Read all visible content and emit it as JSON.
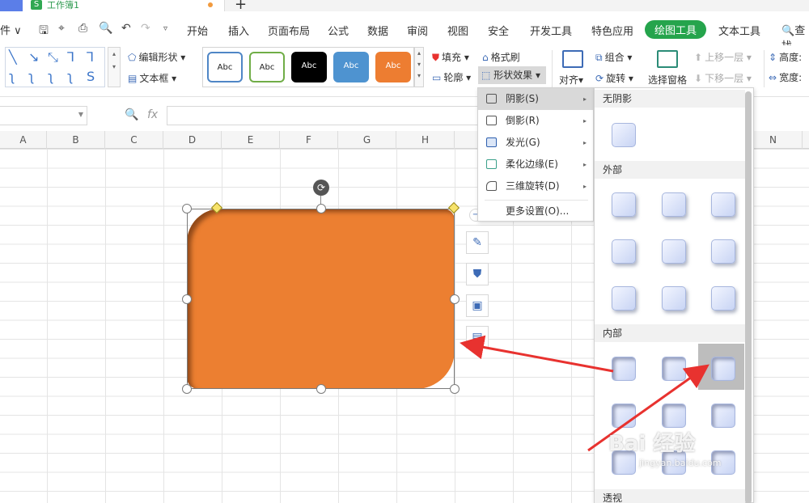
{
  "tabbar": {
    "doc_icon": "S",
    "doc_name": "工作簿1"
  },
  "menubar": {
    "file_label": "件 ∨",
    "items": [
      "开始",
      "插入",
      "页面布局",
      "公式",
      "数据",
      "审阅",
      "视图",
      "安全",
      "开发工具",
      "特色应用",
      "绘图工具",
      "文本工具"
    ],
    "active": "绘图工具",
    "search_label": "查找"
  },
  "ribbon": {
    "edit_shape": "编辑形状",
    "textbox": "文本框",
    "style_labels": [
      "Abc",
      "Abc",
      "Abc",
      "Abc",
      "Abc"
    ],
    "style_colors": [
      "#ffffff",
      "#ffffff",
      "#000000",
      "#4e93d0",
      "#ed7d31"
    ],
    "fill": "填充",
    "format_painter": "格式刷",
    "outline": "轮廓",
    "shape_effects": "形状效果",
    "align": "对齐",
    "group": "组合",
    "rotate": "旋转",
    "selection_pane": "选择窗格",
    "bring_forward": "上移一层",
    "send_backward": "下移一层",
    "height": "高度:",
    "width": "宽度:"
  },
  "formulabar": {
    "fx": "fx",
    "value": ""
  },
  "columns": [
    "A",
    "B",
    "C",
    "D",
    "E",
    "F",
    "G",
    "H",
    "N"
  ],
  "dropdown": {
    "items": [
      {
        "label": "阴影(S)",
        "icon": "shadow-icon",
        "has_sub": true,
        "selected": true
      },
      {
        "label": "倒影(R)",
        "icon": "reflection-icon",
        "has_sub": true
      },
      {
        "label": "发光(G)",
        "icon": "glow-icon",
        "has_sub": true
      },
      {
        "label": "柔化边缘(E)",
        "icon": "soft-edge-icon",
        "has_sub": true
      },
      {
        "label": "三维旋转(D)",
        "icon": "3d-rotate-icon",
        "has_sub": true
      }
    ],
    "more": "更多设置(O)..."
  },
  "submenu": {
    "sections": [
      "无阴影",
      "外部",
      "内部",
      "透视"
    ],
    "highlight": "内部 - 第1行第3个"
  },
  "watermark": {
    "brand": "Bai 经验",
    "site": "jingyan.baidu.com"
  },
  "colors": {
    "accent_green": "#25a44c",
    "shape_orange": "#ec7f31",
    "arrow_red": "#e8322f"
  }
}
